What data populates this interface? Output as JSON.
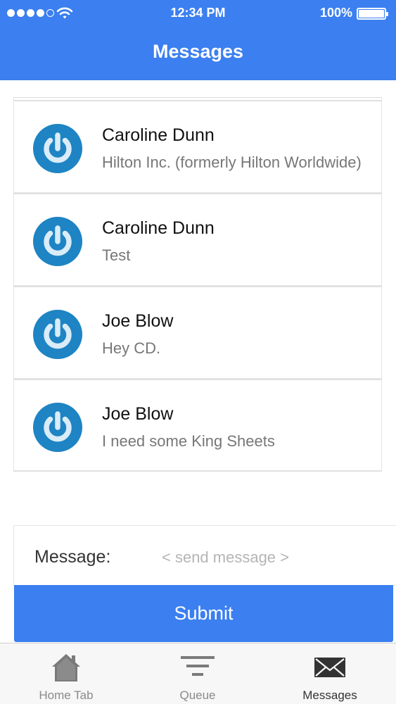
{
  "status_bar": {
    "time": "12:34 PM",
    "battery": "100%",
    "signal_bars": 4,
    "signal_total": 5
  },
  "header": {
    "title": "Messages"
  },
  "messages": [
    {
      "name": "Caroline Dunn",
      "preview": "Hilton Inc. (formerly Hilton Worldwide)",
      "icon": "power-icon"
    },
    {
      "name": "Caroline Dunn",
      "preview": "Test",
      "icon": "power-icon"
    },
    {
      "name": "Joe Blow",
      "preview": "Hey CD.",
      "icon": "power-icon"
    },
    {
      "name": "Joe Blow",
      "preview": "I need some King Sheets",
      "icon": "power-icon"
    }
  ],
  "compose": {
    "label": "Message:",
    "value": "",
    "placeholder": "< send message >"
  },
  "submit": {
    "label": "Submit"
  },
  "tabs": [
    {
      "label": "Home Tab",
      "icon": "home-icon",
      "active": false
    },
    {
      "label": "Queue",
      "icon": "filter-icon",
      "active": false
    },
    {
      "label": "Messages",
      "icon": "envelope-icon",
      "active": true
    }
  ],
  "colors": {
    "accent": "#3b7ff0",
    "avatar_ring": "#1e84c4",
    "avatar_symbol": "#d9ecf8"
  }
}
